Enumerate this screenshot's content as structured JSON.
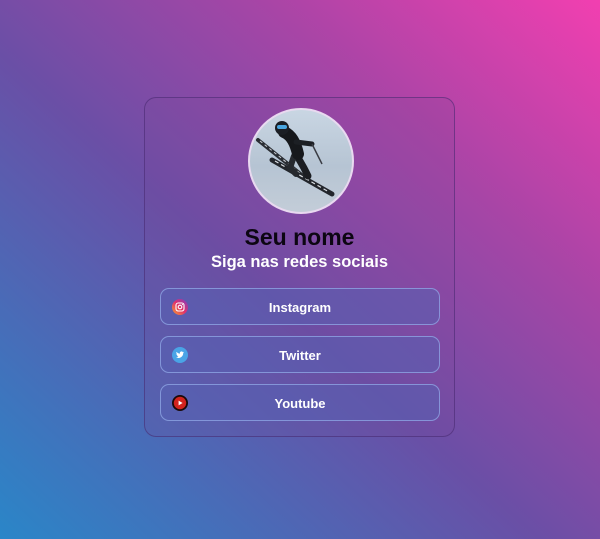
{
  "profile": {
    "name": "Seu nome",
    "subtitle": "Siga nas redes sociais",
    "avatar_icon": "skier-photo"
  },
  "links": [
    {
      "label": "Instagram",
      "icon": "instagram-icon",
      "color": "#d6249f"
    },
    {
      "label": "Twitter",
      "icon": "twitter-icon",
      "color": "#1da1f2"
    },
    {
      "label": "Youtube",
      "icon": "youtube-icon",
      "color": "#c4302b"
    }
  ],
  "colors": {
    "gradient_start": "#2a86c8",
    "gradient_mid": "#a845a6",
    "gradient_end": "#f23fb0"
  }
}
